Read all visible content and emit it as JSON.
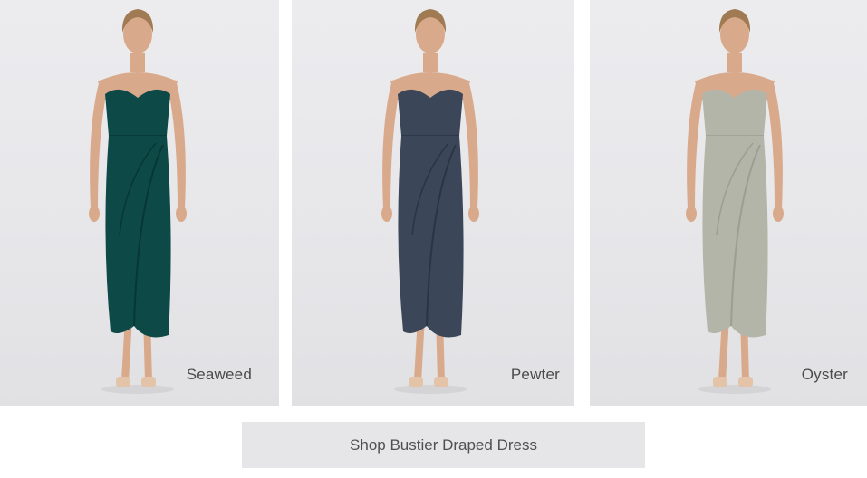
{
  "products": [
    {
      "colour_name": "Seaweed",
      "dress_color": "#0d4a47",
      "dress_shade": "#083634"
    },
    {
      "colour_name": "Pewter",
      "dress_color": "#3b4658",
      "dress_shade": "#2b3443"
    },
    {
      "colour_name": "Oyster",
      "dress_color": "#b3b5a9",
      "dress_shade": "#9c9e92"
    }
  ],
  "cta": {
    "label": "Shop Bustier Draped Dress"
  },
  "colors": {
    "skin": "#d9a98c",
    "hair": "#a07a52",
    "shoe": "#e3c4a8",
    "background": "#e8e8eb"
  }
}
